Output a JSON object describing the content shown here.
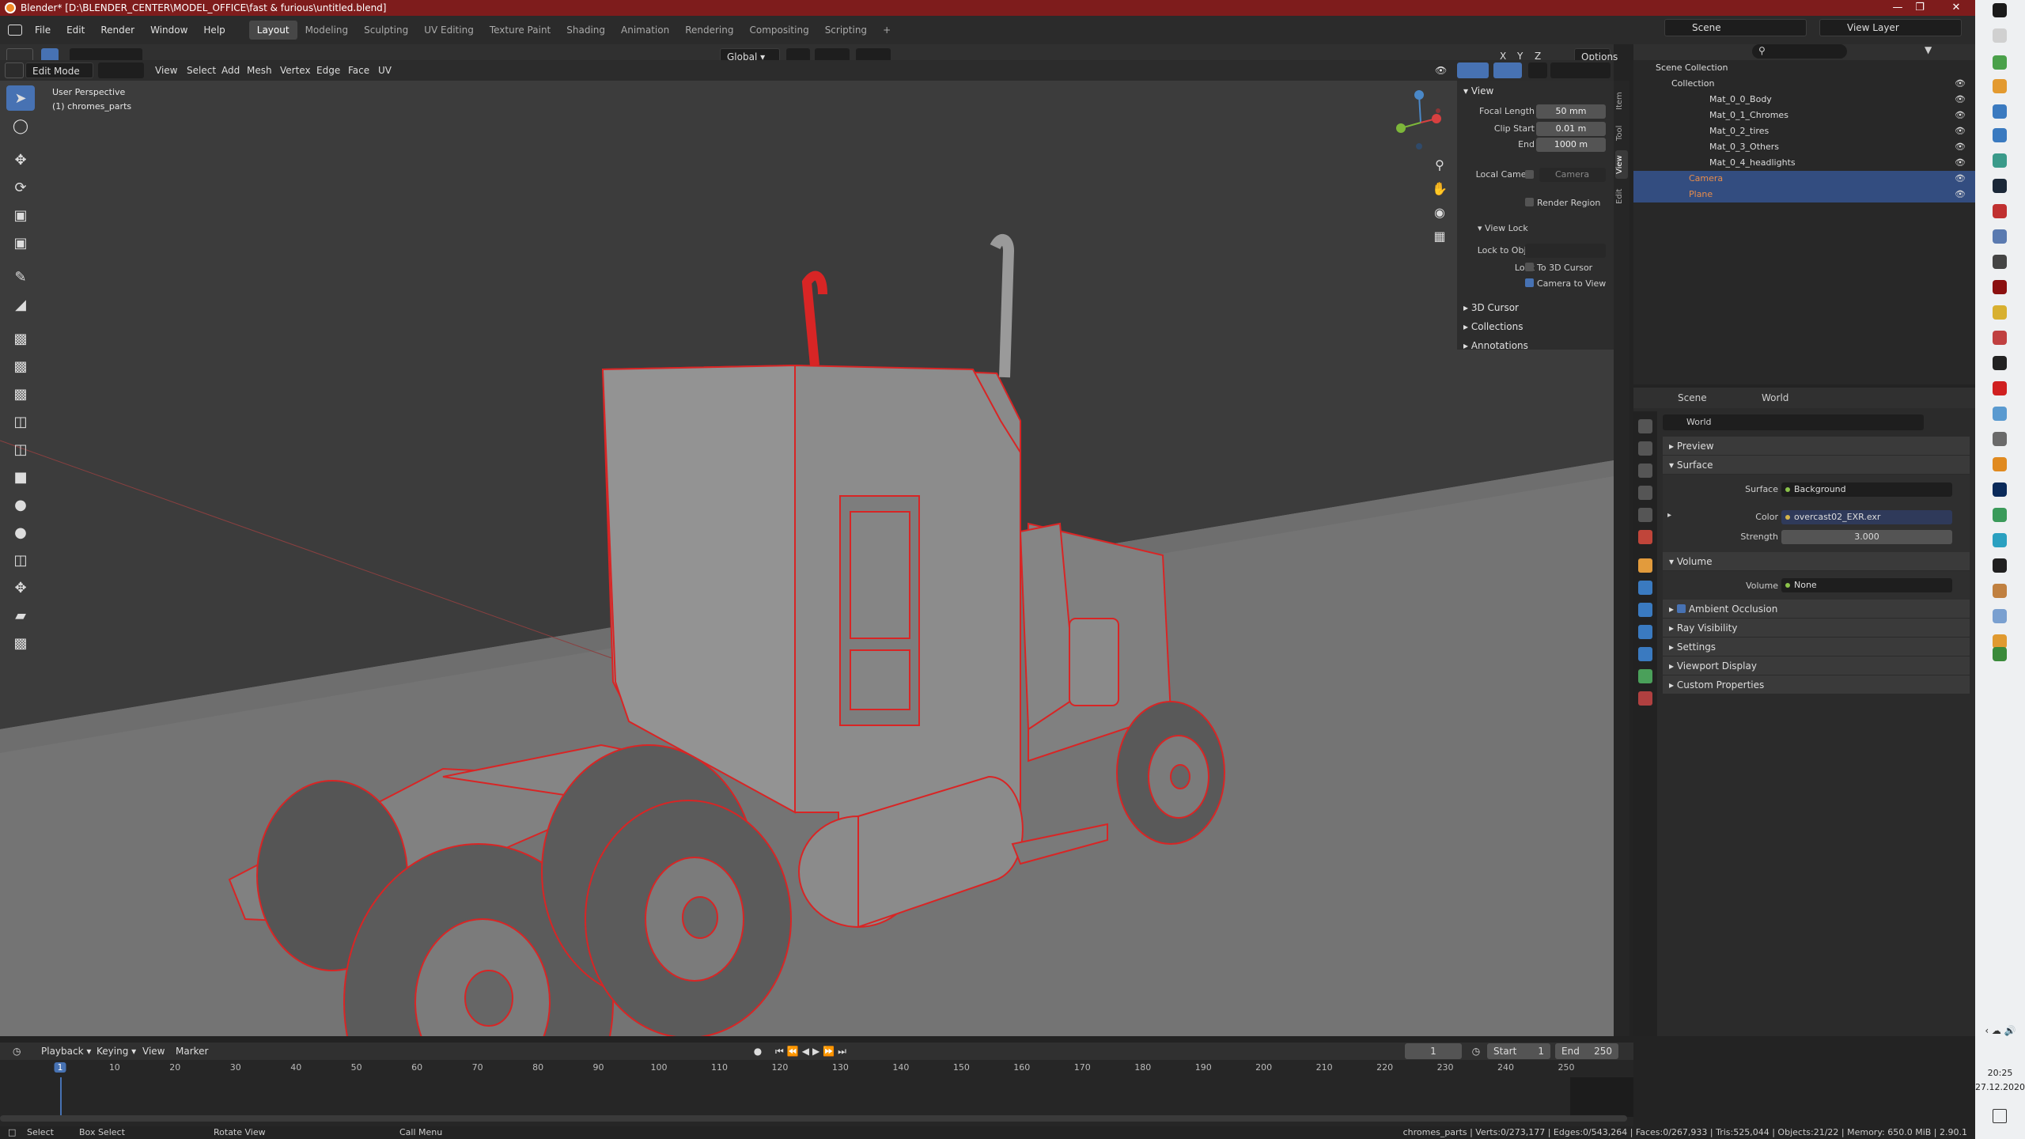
{
  "window": {
    "title": "Blender* [D:\\BLENDER_CENTER\\MODEL_OFFICE\\fast & furious\\untitled.blend]"
  },
  "menu": [
    "File",
    "Edit",
    "Render",
    "Window",
    "Help"
  ],
  "workspaces": [
    "Layout",
    "Modeling",
    "Sculpting",
    "UV Editing",
    "Texture Paint",
    "Shading",
    "Animation",
    "Rendering",
    "Compositing",
    "Scripting",
    "+"
  ],
  "top_right": {
    "scene": "Scene",
    "view_layer": "View Layer"
  },
  "viewport_header": {
    "mode": "Edit Mode",
    "menus": [
      "View",
      "Select",
      "Add",
      "Mesh",
      "Vertex",
      "Edge",
      "Face",
      "UV"
    ],
    "orientation": "Global",
    "options": "Options",
    "axes": [
      "X",
      "Y",
      "Z"
    ]
  },
  "viewport": {
    "perspective": "User Perspective",
    "object": "(1) chromes_parts"
  },
  "npanel": {
    "view_title": "View",
    "focal_label": "Focal Length",
    "focal_value": "50 mm",
    "clip_start_label": "Clip Start",
    "clip_start_value": "0.01 m",
    "end_label": "End",
    "end_value": "1000 m",
    "local_camera_label": "Local Came...",
    "camera_placeholder": "Camera",
    "render_region": "Render Region",
    "view_lock": "View Lock",
    "lock_to_obj": "Lock to Obj...",
    "lock": "Lock",
    "to_3d_cursor": "To 3D Cursor",
    "camera_to_view": "Camera to View",
    "cursor3d": "3D Cursor",
    "collections": "Collections",
    "annotations": "Annotations",
    "tabs": [
      "Item",
      "Tool",
      "View",
      "Edit"
    ]
  },
  "outliner": {
    "search_placeholder": "",
    "scene_collection": "Scene Collection",
    "collection": "Collection",
    "items": [
      {
        "name": "Mat_0_0_Body",
        "selected": false
      },
      {
        "name": "Mat_0_1_Chromes",
        "selected": false
      },
      {
        "name": "Mat_0_2_tires",
        "selected": false
      },
      {
        "name": "Mat_0_3_Others",
        "selected": false
      },
      {
        "name": "Mat_0_4_headlights",
        "selected": false
      },
      {
        "name": "Camera",
        "selected": true
      },
      {
        "name": "Plane",
        "selected": true
      }
    ]
  },
  "properties": {
    "breadcrumb_scene": "Scene",
    "breadcrumb_world": "World",
    "world_name": "World",
    "preview": "Preview",
    "surface": "Surface",
    "surface_label": "Surface",
    "surface_value": "Background",
    "color_label": "Color",
    "color_value": "overcast02_EXR.exr",
    "strength_label": "Strength",
    "strength_value": "3.000",
    "volume_section": "Volume",
    "volume_label": "Volume",
    "volume_value": "None",
    "ambient_occlusion": "Ambient Occlusion",
    "ray_visibility": "Ray Visibility",
    "settings": "Settings",
    "viewport_display": "Viewport Display",
    "custom_properties": "Custom Properties"
  },
  "timeline": {
    "menus": [
      "Playback",
      "Keying",
      "View",
      "Marker"
    ],
    "current_frame": "1",
    "start_label": "Start",
    "start_value": "1",
    "end_label": "End",
    "end_value": "250",
    "ticks": [
      "1",
      "10",
      "20",
      "30",
      "40",
      "50",
      "60",
      "70",
      "80",
      "90",
      "100",
      "110",
      "120",
      "130",
      "140",
      "150",
      "160",
      "170",
      "180",
      "190",
      "200",
      "210",
      "220",
      "230",
      "240",
      "250"
    ]
  },
  "status": {
    "select": "Select",
    "box_select": "Box Select",
    "rotate_view": "Rotate View",
    "call_menu": "Call Menu",
    "stats": "chromes_parts | Verts:0/273,177 | Edges:0/543,264 | Faces:0/267,933 | Tris:525,044 | Objects:21/22 | Memory: 650.0 MiB | 2.90.1"
  },
  "taskbar": {
    "time": "20:25",
    "date": "27.12.2020"
  },
  "colors": {
    "titlebar": "#7e1c1c",
    "accent": "#4772b3",
    "selection": "#334d80",
    "wire_selected": "#e0221f"
  }
}
